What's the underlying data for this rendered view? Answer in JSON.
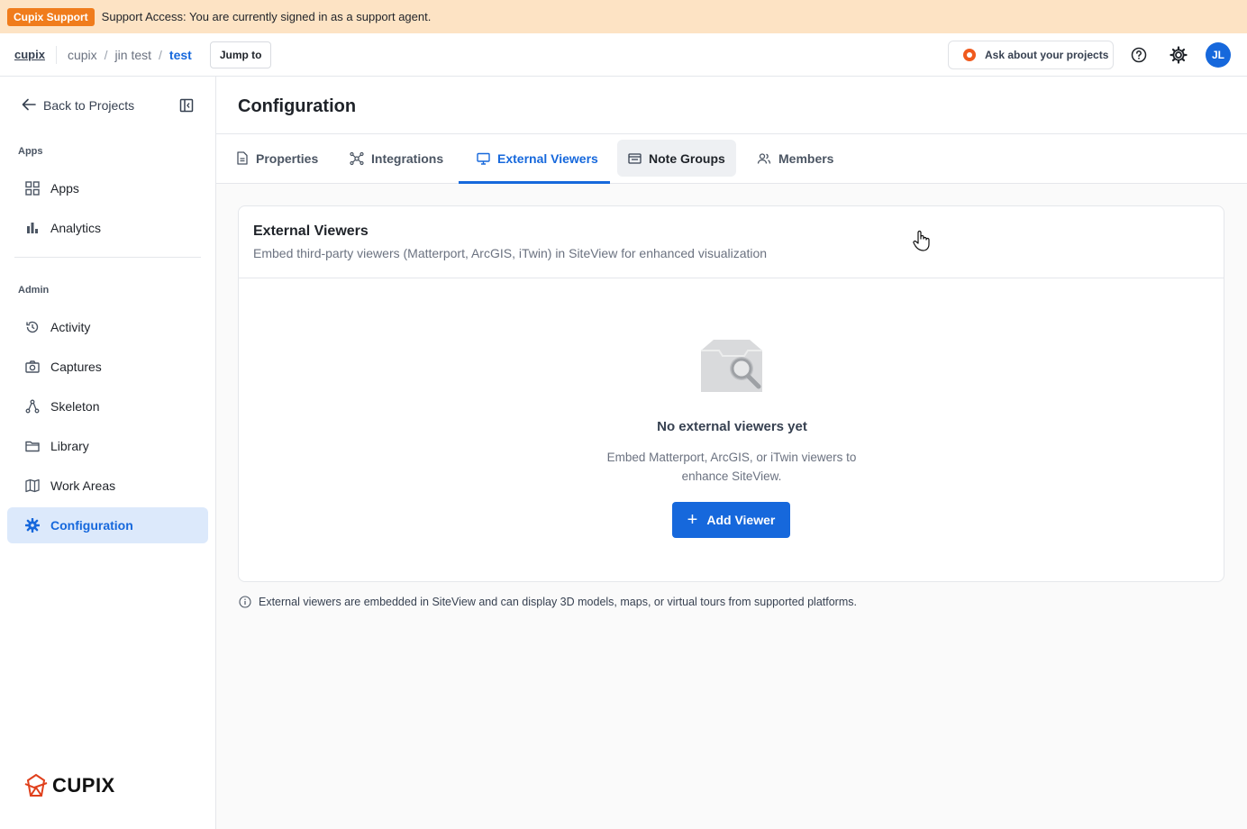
{
  "banner": {
    "badge": "Cupix Support",
    "text": "Support Access: You are currently signed in as a support agent."
  },
  "topbar": {
    "root": "cupix",
    "breadcrumbs": [
      "cupix",
      "jin test",
      "test"
    ],
    "jump_label": "Jump to",
    "ask_label": "Ask about your projects",
    "avatar_initials": "JL"
  },
  "sidebar": {
    "back_label": "Back to Projects",
    "apps_section": "Apps",
    "apps_items": [
      {
        "label": "Apps",
        "icon": "grid-icon"
      },
      {
        "label": "Analytics",
        "icon": "bar-chart-icon"
      }
    ],
    "admin_section": "Admin",
    "admin_items": [
      {
        "label": "Activity",
        "icon": "history-icon"
      },
      {
        "label": "Captures",
        "icon": "camera-icon"
      },
      {
        "label": "Skeleton",
        "icon": "skeleton-icon"
      },
      {
        "label": "Library",
        "icon": "folder-icon"
      },
      {
        "label": "Work Areas",
        "icon": "map-icon"
      },
      {
        "label": "Configuration",
        "icon": "gear-icon",
        "active": true
      }
    ],
    "logo_text": "CUPIX"
  },
  "main": {
    "title": "Configuration",
    "tabs": [
      {
        "label": "Properties",
        "icon": "document-icon"
      },
      {
        "label": "Integrations",
        "icon": "network-icon"
      },
      {
        "label": "External Viewers",
        "icon": "monitor-icon",
        "active": true
      },
      {
        "label": "Note Groups",
        "icon": "notes-icon",
        "hover": true
      },
      {
        "label": "Members",
        "icon": "users-icon"
      }
    ],
    "card": {
      "title": "External Viewers",
      "subtitle": "Embed third-party viewers (Matterport, ArcGIS, iTwin) in SiteView for enhanced visualization",
      "empty_title": "No external viewers yet",
      "empty_desc": "Embed Matterport, ArcGIS, or iTwin viewers to enhance SiteView.",
      "add_label": "Add Viewer"
    },
    "info": "External viewers are embedded in SiteView and can display 3D models, maps, or virtual tours from supported platforms."
  },
  "colors": {
    "accent": "#1668dc",
    "banner_bg": "#fde3c4",
    "badge": "#f07c1c"
  }
}
